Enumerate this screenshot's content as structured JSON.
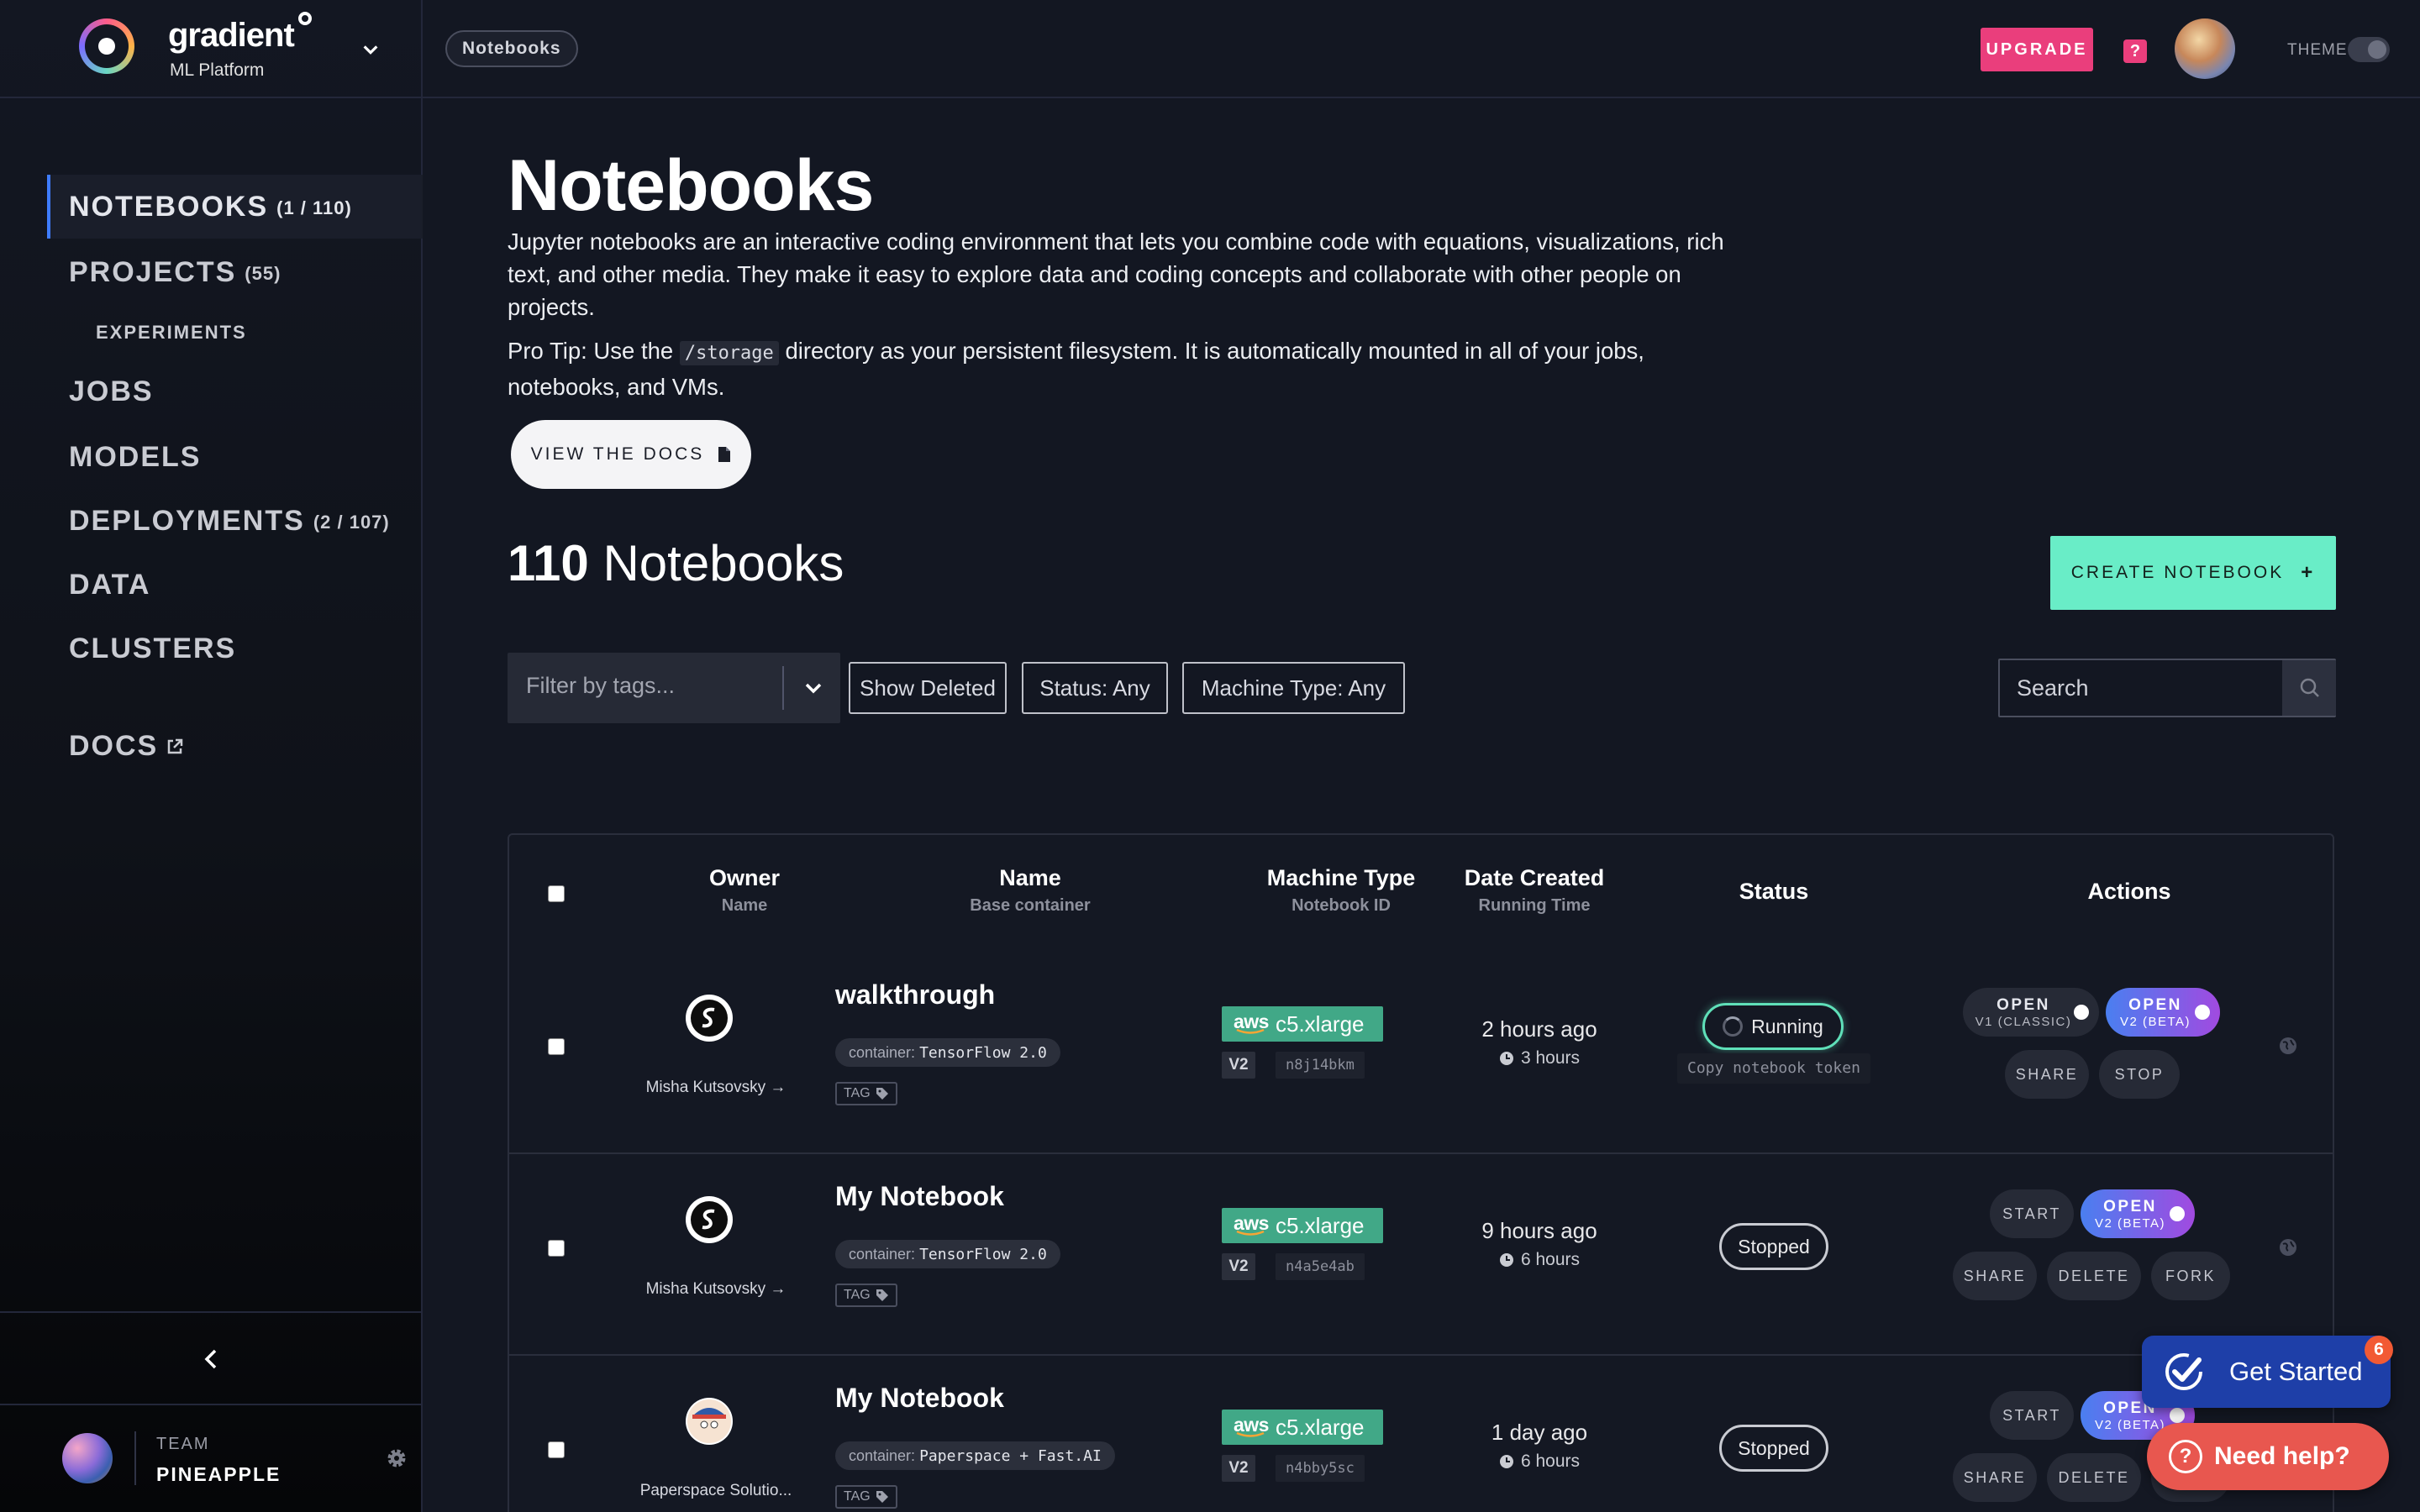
{
  "brand": {
    "name": "gradient",
    "subtitle": "ML Platform"
  },
  "breadcrumb": "Notebooks",
  "topbar": {
    "upgrade": "UPGRADE",
    "help": "?",
    "theme_label": "THEME"
  },
  "sidebar": {
    "items": [
      {
        "label": "NOTEBOOKS",
        "count": "(1 / 110)"
      },
      {
        "label": "PROJECTS",
        "count": "(55)"
      },
      {
        "label": "EXPERIMENTS"
      },
      {
        "label": "JOBS"
      },
      {
        "label": "MODELS"
      },
      {
        "label": "DEPLOYMENTS",
        "count": "(2 / 107)"
      },
      {
        "label": "DATA"
      },
      {
        "label": "CLUSTERS"
      },
      {
        "label": "DOCS"
      }
    ],
    "team_label": "TEAM",
    "team_name": "PINEAPPLE"
  },
  "page": {
    "title": "Notebooks",
    "description": "Jupyter notebooks are an interactive coding environment that lets you combine code with equations, visualizations, rich text, and other media. They make it easy to explore data and coding concepts and collaborate with other people on projects.",
    "tip_prefix": "Pro Tip: Use the",
    "tip_code": "/storage",
    "tip_suffix": "directory as your persistent filesystem. It is automatically mounted in all of your jobs, notebooks, and VMs.",
    "docs_button": "VIEW THE DOCS",
    "count_number": "110",
    "count_label": "Notebooks",
    "create_button": "CREATE NOTEBOOK",
    "create_plus": "+"
  },
  "filters": {
    "tags_placeholder": "Filter by tags...",
    "show_deleted": "Show Deleted",
    "status": "Status: Any",
    "machine_type": "Machine Type: Any",
    "search_placeholder": "Search"
  },
  "table": {
    "headers": {
      "owner": "Owner",
      "owner_sub": "Name",
      "name": "Name",
      "name_sub": "Base container",
      "machine": "Machine Type",
      "machine_sub": "Notebook ID",
      "date": "Date Created",
      "date_sub": "Running Time",
      "status": "Status",
      "actions": "Actions"
    },
    "rows": [
      {
        "owner": "Misha Kutsovsky →",
        "name": "walkthrough",
        "container_label": "container:",
        "container": "TensorFlow 2.0",
        "tag": "TAG",
        "machine": "c5.xlarge",
        "aws": "aws",
        "version": "V2",
        "notebook_id": "n8j14bkm",
        "date": "2 hours ago",
        "runtime": "3 hours",
        "status": "Running",
        "token_hint": "Copy notebook token",
        "actions": {
          "open_v1": "OPEN",
          "open_v1_sub": "V1 (CLASSIC)",
          "open_v2": "OPEN",
          "open_v2_sub": "V2 (BETA)",
          "share": "SHARE",
          "stop": "STOP"
        }
      },
      {
        "owner": "Misha Kutsovsky →",
        "name": "My Notebook",
        "container_label": "container:",
        "container": "TensorFlow 2.0",
        "tag": "TAG",
        "machine": "c5.xlarge",
        "aws": "aws",
        "version": "V2",
        "notebook_id": "n4a5e4ab",
        "date": "9 hours ago",
        "runtime": "6 hours",
        "status": "Stopped",
        "actions": {
          "start": "START",
          "open_v2": "OPEN",
          "open_v2_sub": "V2 (BETA)",
          "share": "SHARE",
          "delete": "DELETE",
          "fork": "FORK"
        }
      },
      {
        "owner": "Paperspace Solutio...",
        "name": "My Notebook",
        "container_label": "container:",
        "container": "Paperspace + Fast.AI",
        "tag": "TAG",
        "machine": "c5.xlarge",
        "aws": "aws",
        "version": "V2",
        "notebook_id": "n4bby5sc",
        "date": "1 day ago",
        "runtime": "6 hours",
        "status": "Stopped",
        "actions": {
          "start": "START",
          "open_v2": "OPEN",
          "open_v2_sub": "V2 (BETA)",
          "share": "SHARE",
          "delete": "DELETE",
          "fork": "FORK"
        }
      }
    ]
  },
  "widgets": {
    "get_started": "Get Started",
    "get_started_badge": "6",
    "need_help": "Need help?",
    "need_help_icon": "?"
  },
  "colors": {
    "accent_teal": "#69edc7",
    "upgrade_pink": "#ea3e7c",
    "background": "#131722",
    "running_green": "#5fe0b9"
  }
}
